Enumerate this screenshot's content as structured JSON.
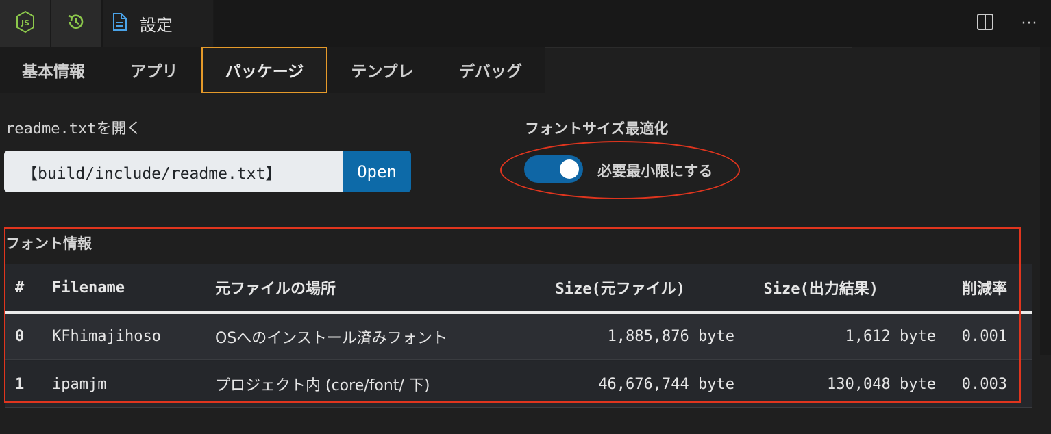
{
  "titlebar": {
    "tab_title": "設定",
    "icons": [
      "nodejs-icon",
      "history-icon",
      "file-icon",
      "split-editor-icon",
      "more-icon"
    ],
    "more_glyph": "···"
  },
  "nav": {
    "tabs": [
      {
        "label": "基本情報",
        "active": false
      },
      {
        "label": "アプリ",
        "active": false
      },
      {
        "label": "パッケージ",
        "active": true
      },
      {
        "label": "テンプレ",
        "active": false
      },
      {
        "label": "デバッグ",
        "active": false
      }
    ]
  },
  "readme": {
    "label": "readme.txtを開く",
    "path": "【build/include/readme.txt】",
    "open_label": "Open"
  },
  "font_option": {
    "label": "フォントサイズ最適化",
    "toggle_on": true,
    "toggle_label": "必要最小限にする"
  },
  "font_info": {
    "title": "フォント情報",
    "columns": [
      "#",
      "Filename",
      "元ファイルの場所",
      "Size(元ファイル)",
      "Size(出力結果)",
      "削減率"
    ],
    "rows": [
      [
        "0",
        "KFhimajihoso",
        "OSへのインストール済みフォント",
        "1,885,876 byte",
        "1,612 byte",
        "0.001"
      ],
      [
        "1",
        "ipamjm",
        "プロジェクト内 (core/font/ 下)",
        "46,676,744 byte",
        "130,048 byte",
        "0.003"
      ]
    ]
  },
  "colors": {
    "accent": "#0d6aa8",
    "active_tab_border": "#e59a2a",
    "annotation_red": "#e0351e"
  }
}
